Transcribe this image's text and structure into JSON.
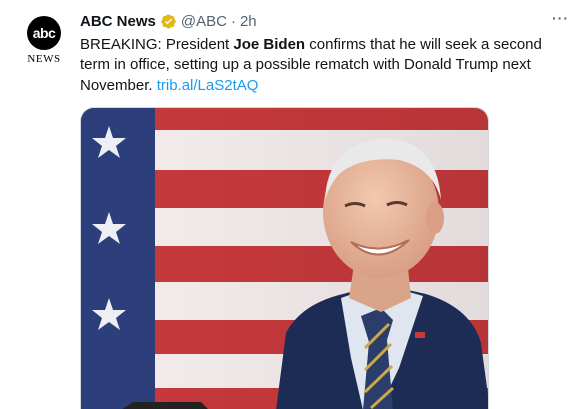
{
  "tweet": {
    "avatar": {
      "logo_text": "abc",
      "label": "NEWS"
    },
    "author_name": "ABC News",
    "handle": "@ABC",
    "separator": "·",
    "time": "2h",
    "more_label": "···",
    "text_part1": "BREAKING: President ",
    "text_bold": "Joe Biden",
    "text_part2": " confirms that he will seek a second term in office, setting up a possible rematch with Donald Trump next November. ",
    "link": "trib.al/LaS2tAQ"
  },
  "colors": {
    "link": "#1d9bf0",
    "verified_badge": "#e2b719",
    "flag_red": "#c8393c",
    "flag_blue": "#2c3f7c",
    "suit": "#1c2c54"
  },
  "icons": [
    "verified-badge-icon",
    "more-icon"
  ]
}
